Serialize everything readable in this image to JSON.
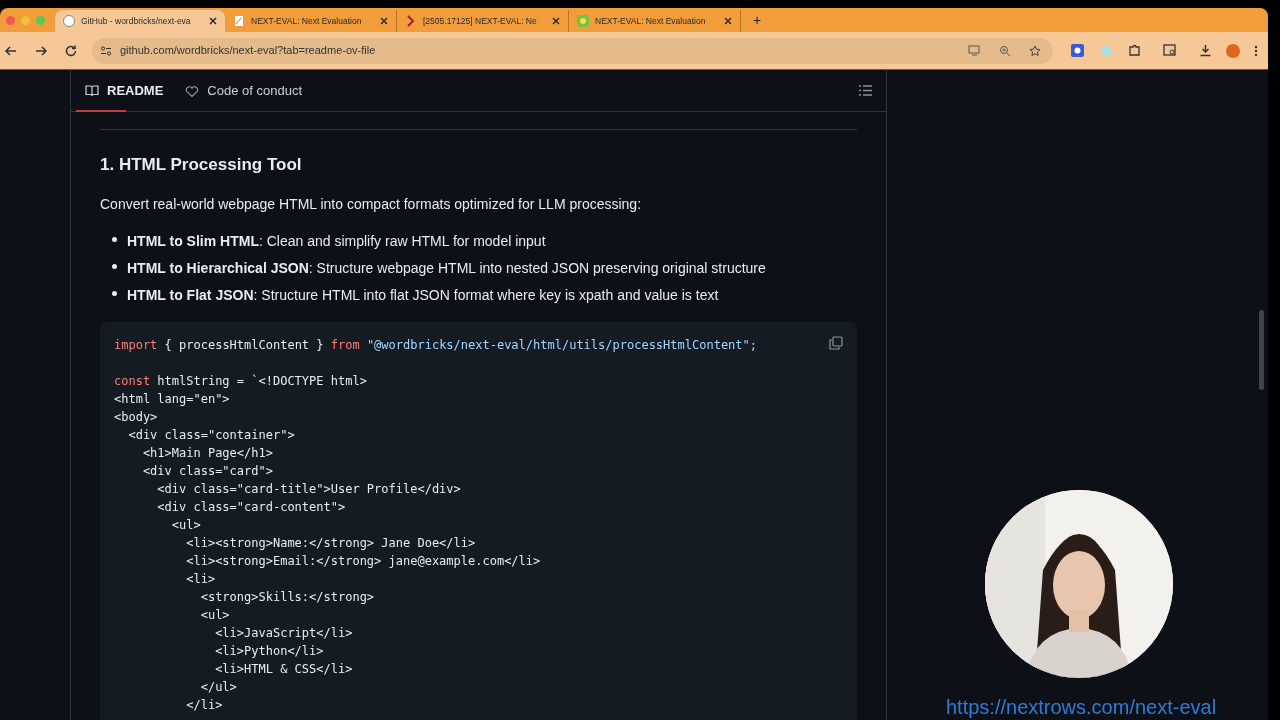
{
  "browser": {
    "tabs": [
      {
        "title": "GitHub - wordbricks/next-eva",
        "selected": true
      },
      {
        "title": "NEXT-EVAL: Next Evaluation",
        "selected": false
      },
      {
        "title": "[2505.17125] NEXT-EVAL: Ne",
        "selected": false
      },
      {
        "title": "NEXT-EVAL: Next Evaluation",
        "selected": false
      }
    ],
    "new_tab": "+",
    "address": "github.com/wordbricks/next-eval?tab=readme-ov-file"
  },
  "readme": {
    "tabs": [
      {
        "label": "README",
        "selected": true
      },
      {
        "label": "Code of conduct",
        "selected": false
      }
    ],
    "heading": "1. HTML Processing Tool",
    "intro": "Convert real-world webpage HTML into compact formats optimized for LLM processing:",
    "bullets": [
      "**HTML to Slim HTML**: Clean and simplify raw HTML for model input",
      "**HTML to Hierarchical JSON**: Structure webpage HTML into nested JSON preserving original structure",
      "**HTML to Flat JSON**: Structure HTML into flat JSON format where key is xpath and value is text"
    ],
    "code": [
      {
        "segments": [
          {
            "text": "import",
            "kind": "keyword"
          },
          {
            "text": " { processHtmlContent } ",
            "kind": "plain"
          },
          {
            "text": "from",
            "kind": "keyword"
          },
          {
            "text": " \"@wordbricks/next-eval/html/utils/processHtmlContent\";",
            "kind": "string"
          }
        ]
      },
      {
        "space_before": true,
        "segments": [
          {
            "text": "const",
            "kind": "keyword"
          },
          {
            "text": " htmlString = `<!DOCTYPE html>",
            "kind": "plain"
          }
        ]
      },
      {
        "segments": [
          {
            "text": "<html lang=\"en\">",
            "kind": "plain"
          }
        ]
      },
      {
        "segments": [
          {
            "text": "<body>",
            "kind": "plain"
          }
        ]
      },
      {
        "segments": [
          {
            "text": "  <div class=\"container\">",
            "kind": "plain"
          }
        ]
      },
      {
        "segments": [
          {
            "text": "    <h1>Main Page</h1>",
            "kind": "plain"
          }
        ]
      },
      {
        "segments": [
          {
            "text": "    <div class=\"card\">",
            "kind": "plain"
          }
        ]
      },
      {
        "segments": [
          {
            "text": "      <div class=\"card-title\">User Profile</div>",
            "kind": "plain"
          }
        ]
      },
      {
        "segments": [
          {
            "text": "      <div class=\"card-content\">",
            "kind": "plain"
          }
        ]
      },
      {
        "segments": [
          {
            "text": "        <ul>",
            "kind": "plain"
          }
        ]
      },
      {
        "segments": [
          {
            "text": "          <li><strong>Name:</strong> Jane Doe</li>",
            "kind": "plain"
          }
        ]
      },
      {
        "segments": [
          {
            "text": "          <li><strong>Email:</strong> jane@example.com</li>",
            "kind": "plain"
          }
        ]
      },
      {
        "segments": [
          {
            "text": "          <li>",
            "kind": "plain"
          }
        ]
      },
      {
        "segments": [
          {
            "text": "            <strong>Skills:</strong>",
            "kind": "plain"
          }
        ]
      },
      {
        "segments": [
          {
            "text": "            <ul>",
            "kind": "plain"
          }
        ]
      },
      {
        "segments": [
          {
            "text": "              <li>JavaScript</li>",
            "kind": "plain"
          }
        ]
      },
      {
        "segments": [
          {
            "text": "              <li>Python</li>",
            "kind": "plain"
          }
        ]
      },
      {
        "segments": [
          {
            "text": "              <li>HTML & CSS</li>",
            "kind": "plain"
          }
        ]
      },
      {
        "segments": [
          {
            "text": "            </ul>",
            "kind": "plain"
          }
        ]
      },
      {
        "segments": [
          {
            "text": "          </li>",
            "kind": "plain"
          }
        ]
      }
    ]
  },
  "overlay_link": "https://nextrows.com/next-eval"
}
